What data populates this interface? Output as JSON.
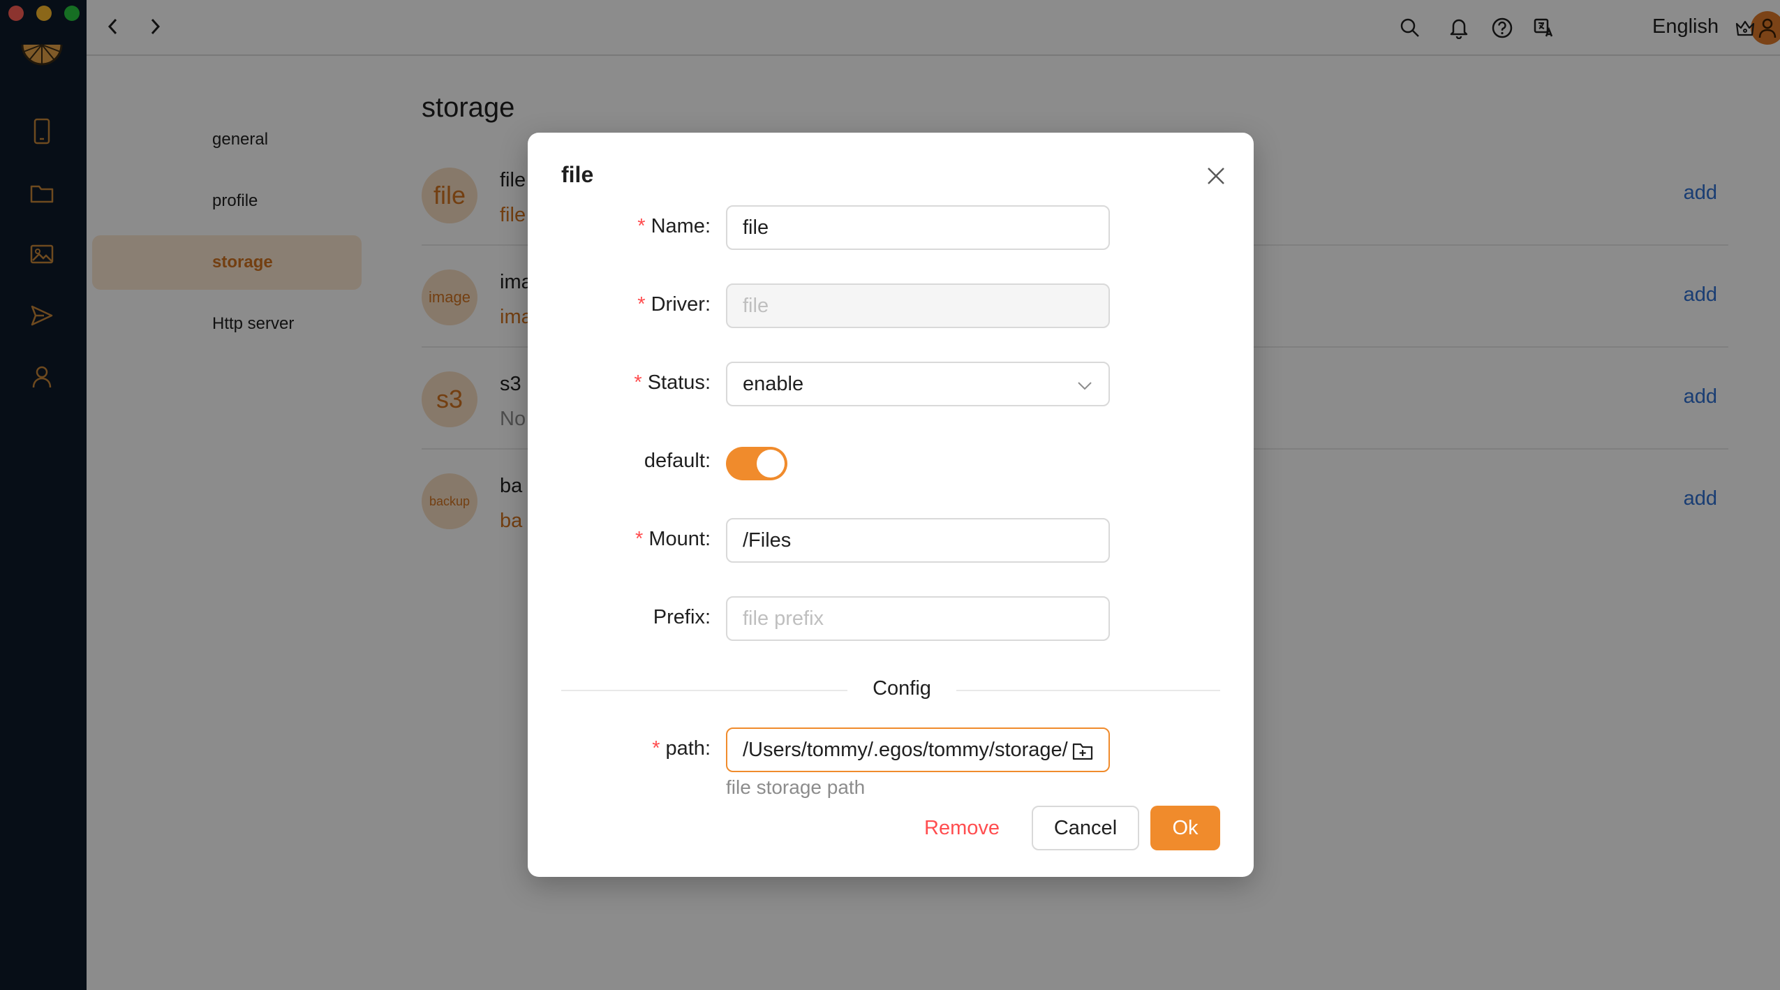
{
  "window": {
    "traffic_lights": [
      "close",
      "minimize",
      "zoom"
    ]
  },
  "sidebar": {
    "icons": [
      "logo",
      "phone-icon",
      "folder-icon",
      "image-icon",
      "send-icon",
      "user-icon"
    ]
  },
  "topbar": {
    "language": "English",
    "icons": [
      "search-icon",
      "bell-icon",
      "help-icon",
      "translate-icon",
      "avatar",
      "crown-icon"
    ]
  },
  "settings_nav": {
    "items": [
      {
        "label": "general"
      },
      {
        "label": "profile"
      },
      {
        "label": "storage",
        "active": true
      },
      {
        "label": "Http server"
      }
    ]
  },
  "main": {
    "title": "storage",
    "rows": [
      {
        "avatar": "file",
        "name": "file",
        "sub": "file",
        "action": "add"
      },
      {
        "avatar": "image",
        "name": "ima",
        "sub": "ima",
        "action": "add"
      },
      {
        "avatar": "s3",
        "name": "s3",
        "sub": "No",
        "action": "add"
      },
      {
        "avatar": "backup",
        "name": "ba",
        "sub": "ba",
        "action": "add"
      }
    ]
  },
  "modal": {
    "title": "file",
    "fields": {
      "name": {
        "label": "Name",
        "value": "file",
        "required": true
      },
      "driver": {
        "label": "Driver",
        "value": "file",
        "required": true,
        "disabled": true
      },
      "status": {
        "label": "Status",
        "value": "enable",
        "required": true
      },
      "default": {
        "label": "default",
        "value": true
      },
      "mount": {
        "label": "Mount",
        "value": "/Files",
        "required": true
      },
      "prefix": {
        "label": "Prefix",
        "placeholder": "file prefix"
      },
      "path": {
        "label": "path",
        "value": "/Users/tommy/.egos/tommy/storage/",
        "help": "file storage path",
        "required": true
      }
    },
    "section_divider": "Config",
    "colon": ":",
    "required_mark": "*",
    "buttons": {
      "remove": "Remove",
      "cancel": "Cancel",
      "ok": "Ok"
    }
  },
  "colors": {
    "accent": "#f08b2c",
    "danger": "#ff4d4f",
    "link": "#2f6fd1",
    "sidebar_bg": "#0e1a2b"
  }
}
